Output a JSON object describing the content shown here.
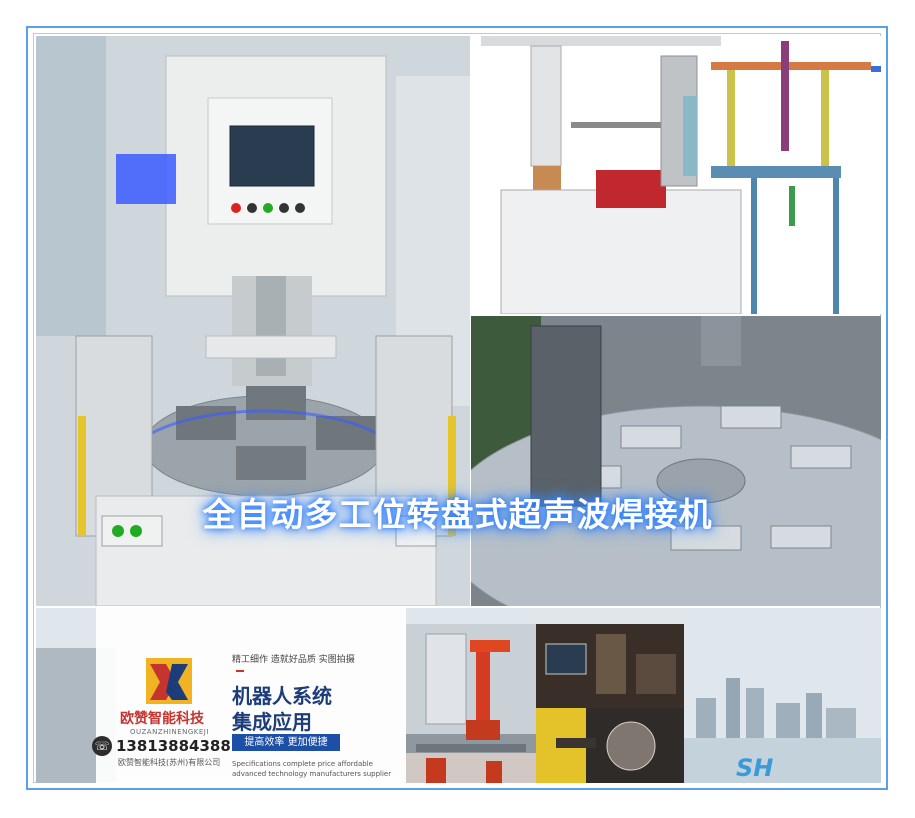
{
  "title": "全自动多工位转盘式超声波焊接机",
  "colors": {
    "frame": "#5aa0e6",
    "title_glow": "#2a7bff",
    "brand_red": "#c5352f",
    "brand_navy": "#1d3d7a",
    "pill_blue": "#1e4fa6"
  },
  "banner": {
    "brand_cn": "欧赞智能科技",
    "brand_en": "OUZANZHINENGKEJI",
    "phone": "13813884388",
    "company_small": "欧赞智能科技(苏州)有限公司",
    "tagline": "精工细作  造就好品质  实图拍摄",
    "headline_line1": "机器人系统",
    "headline_line2": "集成应用",
    "pill": "提高效率   更加便捷",
    "spec_line1": "Specifications complete price affordable",
    "spec_line2": "advanced technology manufacturers supplier"
  },
  "icons": [
    "phone-icon",
    "brand-logo-icon",
    "sh-logo-icon"
  ]
}
